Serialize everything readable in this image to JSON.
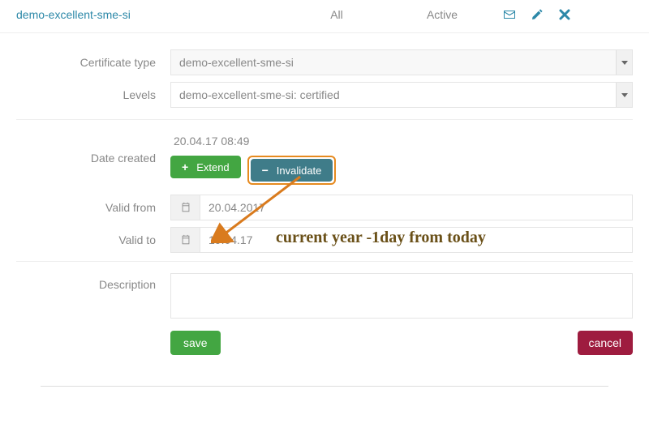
{
  "tabs": {
    "link": "demo-excellent-sme-si",
    "all": "All",
    "active": "Active"
  },
  "labels": {
    "cert_type": "Certificate type",
    "levels": "Levels",
    "date_created": "Date created",
    "valid_from": "Valid from",
    "valid_to": "Valid to",
    "description": "Description"
  },
  "fields": {
    "cert_type_value": "demo-excellent-sme-si",
    "levels_value": "demo-excellent-sme-si: certified",
    "date_created_value": "20.04.17 08:49",
    "valid_from_value": "20.04.2017",
    "valid_to_value": "19.04.17",
    "description_value": ""
  },
  "buttons": {
    "extend": "Extend",
    "invalidate": "Invalidate",
    "save": "save",
    "cancel": "cancel"
  },
  "annotation": {
    "text": "current year -1day from today"
  }
}
